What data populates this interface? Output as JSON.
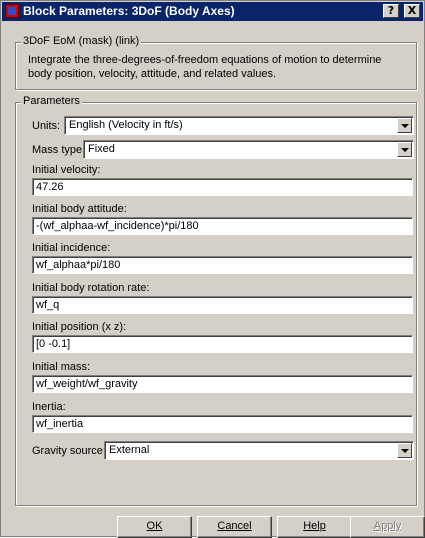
{
  "window": {
    "title": "Block Parameters: 3DoF (Body Axes)",
    "help_glyph": "?",
    "close_glyph": "X",
    "icon": "simulink-block-icon"
  },
  "mask": {
    "group_title": "3DoF EoM (mask) (link)",
    "description": "Integrate the three-degrees-of-freedom equations of motion to determine body position, velocity, attitude, and related values."
  },
  "parameters": {
    "group_title": "Parameters",
    "units": {
      "label": "Units:",
      "value": "English (Velocity in ft/s)"
    },
    "mass_type": {
      "label": "Mass type:",
      "value": "Fixed"
    },
    "initial_velocity": {
      "label": "Initial velocity:",
      "value": "47.26"
    },
    "initial_body_attitude": {
      "label": "Initial body attitude:",
      "value": "-(wf_alphaa-wf_incidence)*pi/180"
    },
    "initial_incidence": {
      "label": "Initial incidence:",
      "value": "wf_alphaa*pi/180"
    },
    "initial_body_rotation_rate": {
      "label": "Initial body rotation rate:",
      "value": "wf_q"
    },
    "initial_position": {
      "label": "Initial position (x z):",
      "value": "[0 -0.1]"
    },
    "initial_mass": {
      "label": "Initial mass:",
      "value": "wf_weight/wf_gravity"
    },
    "inertia": {
      "label": "Inertia:",
      "value": "wf_inertia"
    },
    "gravity_source": {
      "label": "Gravity source:",
      "value": "External"
    }
  },
  "buttons": {
    "ok": "OK",
    "cancel": "Cancel",
    "help": "Help",
    "apply": "Apply"
  }
}
